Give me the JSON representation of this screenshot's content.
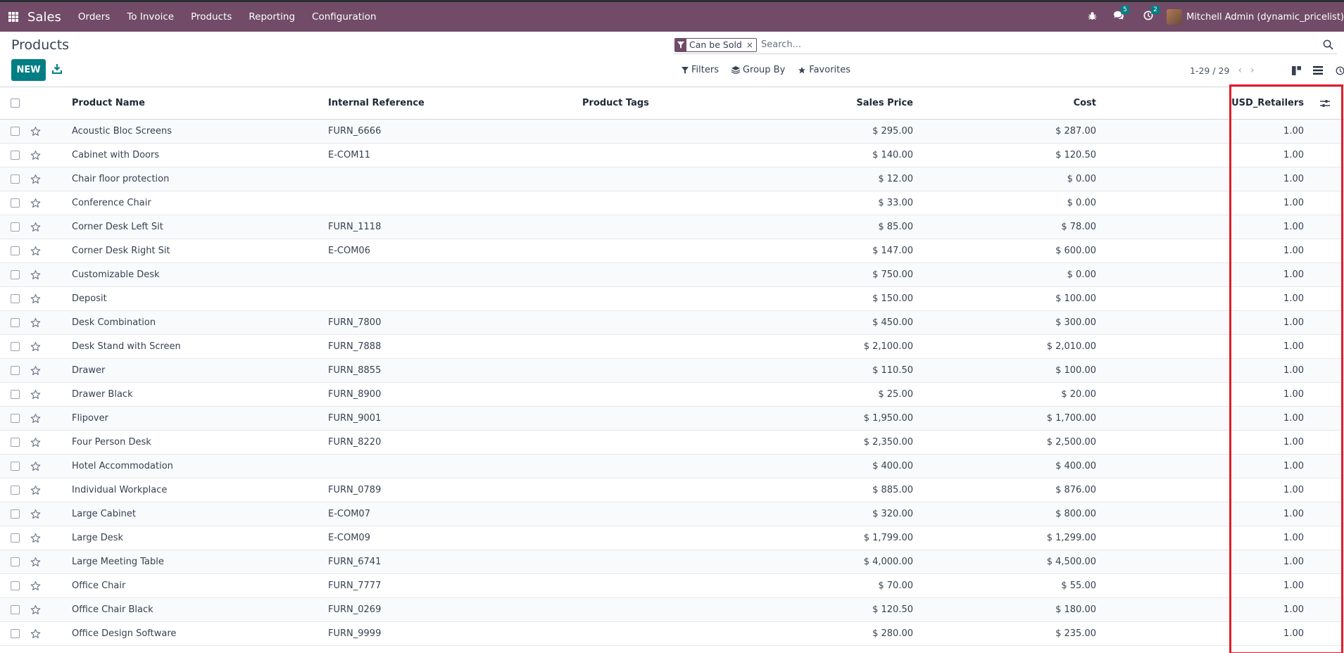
{
  "navbar": {
    "app": "Sales",
    "menu": [
      "Orders",
      "To Invoice",
      "Products",
      "Reporting",
      "Configuration"
    ],
    "messages_badge": "5",
    "activities_badge": "2",
    "user": "Mitchell Admin (dynamic_pricelist)"
  },
  "control": {
    "title": "Products",
    "new_label": "NEW",
    "facet": "Can be Sold",
    "search_placeholder": "Search...",
    "filters": "Filters",
    "group_by": "Group By",
    "favorites": "Favorites",
    "pager": "1-29 / 29"
  },
  "table": {
    "columns": {
      "name": "Product Name",
      "ref": "Internal Reference",
      "tags": "Product Tags",
      "price": "Sales Price",
      "cost": "Cost",
      "usd": "USD_Retailers"
    },
    "rows": [
      {
        "name": "Acoustic Bloc Screens",
        "ref": "FURN_6666",
        "price": "$ 295.00",
        "cost": "$ 287.00",
        "usd": "1.00"
      },
      {
        "name": "Cabinet with Doors",
        "ref": "E-COM11",
        "price": "$ 140.00",
        "cost": "$ 120.50",
        "usd": "1.00"
      },
      {
        "name": "Chair floor protection",
        "ref": "",
        "price": "$ 12.00",
        "cost": "$ 0.00",
        "usd": "1.00"
      },
      {
        "name": "Conference Chair",
        "ref": "",
        "price": "$ 33.00",
        "cost": "$ 0.00",
        "usd": "1.00"
      },
      {
        "name": "Corner Desk Left Sit",
        "ref": "FURN_1118",
        "price": "$ 85.00",
        "cost": "$ 78.00",
        "usd": "1.00"
      },
      {
        "name": "Corner Desk Right Sit",
        "ref": "E-COM06",
        "price": "$ 147.00",
        "cost": "$ 600.00",
        "usd": "1.00"
      },
      {
        "name": "Customizable Desk",
        "ref": "",
        "price": "$ 750.00",
        "cost": "$ 0.00",
        "usd": "1.00"
      },
      {
        "name": "Deposit",
        "ref": "",
        "price": "$ 150.00",
        "cost": "$ 100.00",
        "usd": "1.00"
      },
      {
        "name": "Desk Combination",
        "ref": "FURN_7800",
        "price": "$ 450.00",
        "cost": "$ 300.00",
        "usd": "1.00"
      },
      {
        "name": "Desk Stand with Screen",
        "ref": "FURN_7888",
        "price": "$ 2,100.00",
        "cost": "$ 2,010.00",
        "usd": "1.00"
      },
      {
        "name": "Drawer",
        "ref": "FURN_8855",
        "price": "$ 110.50",
        "cost": "$ 100.00",
        "usd": "1.00"
      },
      {
        "name": "Drawer Black",
        "ref": "FURN_8900",
        "price": "$ 25.00",
        "cost": "$ 20.00",
        "usd": "1.00"
      },
      {
        "name": "Flipover",
        "ref": "FURN_9001",
        "price": "$ 1,950.00",
        "cost": "$ 1,700.00",
        "usd": "1.00"
      },
      {
        "name": "Four Person Desk",
        "ref": "FURN_8220",
        "price": "$ 2,350.00",
        "cost": "$ 2,500.00",
        "usd": "1.00"
      },
      {
        "name": "Hotel Accommodation",
        "ref": "",
        "price": "$ 400.00",
        "cost": "$ 400.00",
        "usd": "1.00"
      },
      {
        "name": "Individual Workplace",
        "ref": "FURN_0789",
        "price": "$ 885.00",
        "cost": "$ 876.00",
        "usd": "1.00"
      },
      {
        "name": "Large Cabinet",
        "ref": "E-COM07",
        "price": "$ 320.00",
        "cost": "$ 800.00",
        "usd": "1.00"
      },
      {
        "name": "Large Desk",
        "ref": "E-COM09",
        "price": "$ 1,799.00",
        "cost": "$ 1,299.00",
        "usd": "1.00"
      },
      {
        "name": "Large Meeting Table",
        "ref": "FURN_6741",
        "price": "$ 4,000.00",
        "cost": "$ 4,500.00",
        "usd": "1.00"
      },
      {
        "name": "Office Chair",
        "ref": "FURN_7777",
        "price": "$ 70.00",
        "cost": "$ 55.00",
        "usd": "1.00"
      },
      {
        "name": "Office Chair Black",
        "ref": "FURN_0269",
        "price": "$ 120.50",
        "cost": "$ 180.00",
        "usd": "1.00"
      },
      {
        "name": "Office Design Software",
        "ref": "FURN_9999",
        "price": "$ 280.00",
        "cost": "$ 235.00",
        "usd": "1.00"
      }
    ]
  },
  "colors": {
    "brand": "#714b67",
    "primary": "#017e84",
    "highlight": "#e11d2a"
  }
}
